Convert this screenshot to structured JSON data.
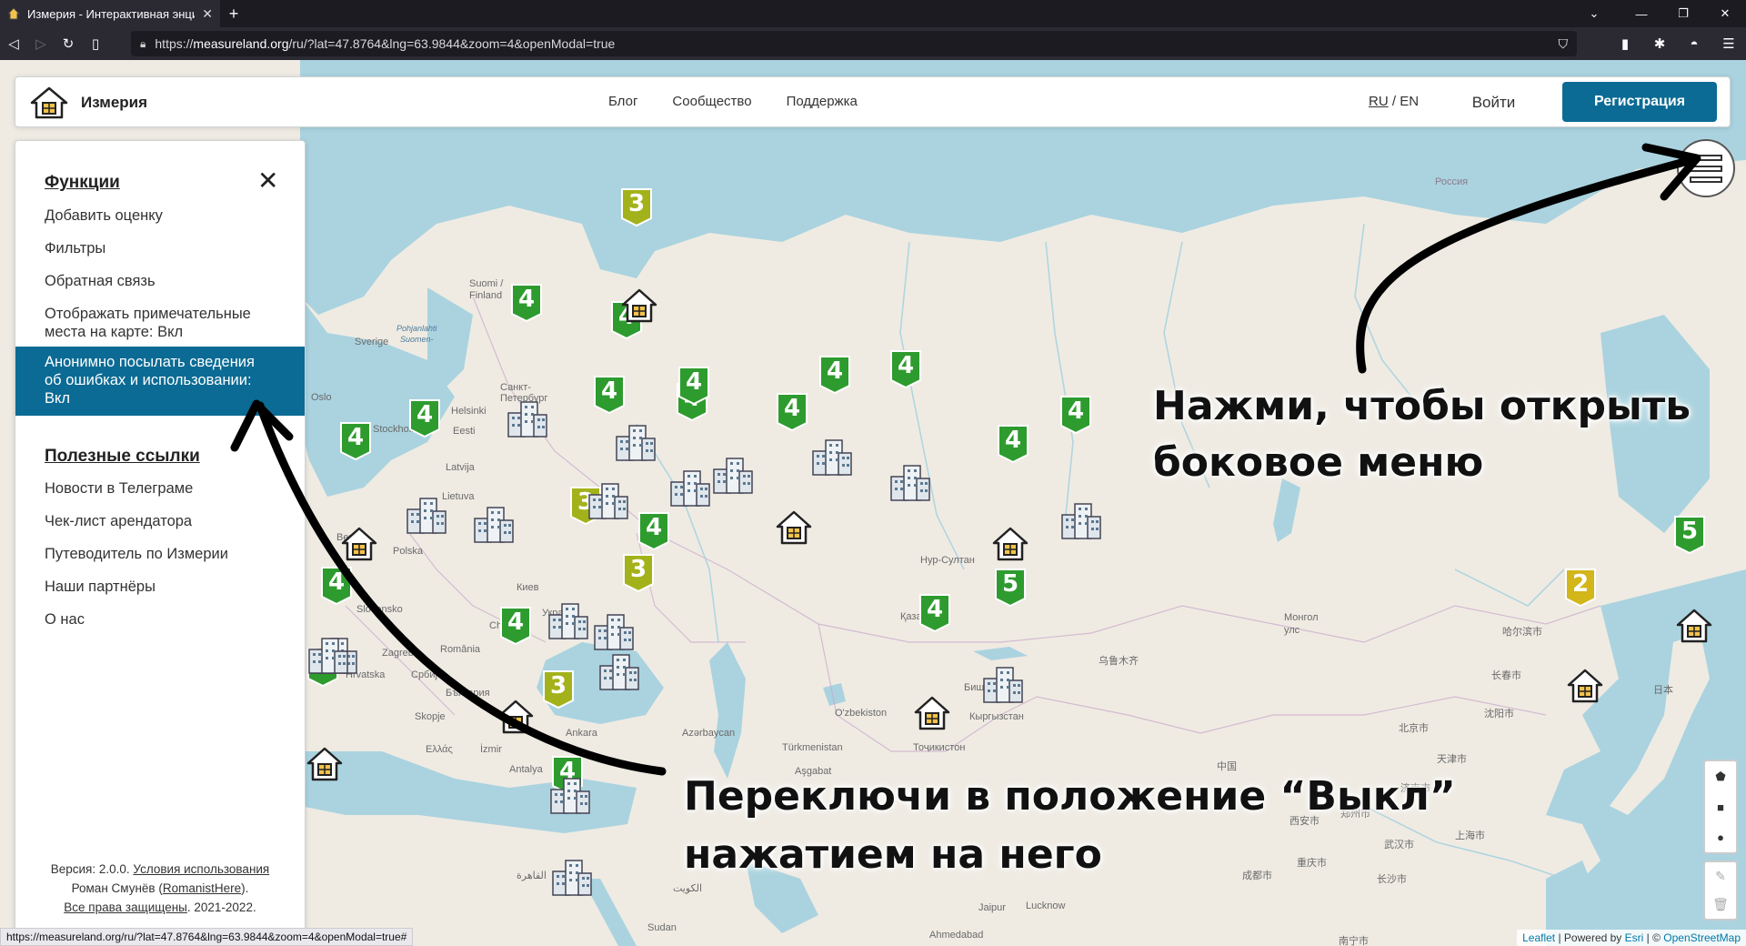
{
  "browser": {
    "tab_title": "Измерия - Интерактивная энцик",
    "new_tab": "+",
    "url_prefix": "https://",
    "url_host": "measureland.org",
    "url_path": "/ru/?lat=47.8764&lng=63.9844&zoom=4&openModal=true",
    "status_url": "https://measureland.org/ru/?lat=47.8764&lng=63.9844&zoom=4&openModal=true#"
  },
  "header": {
    "brand": "Измерия",
    "nav": [
      "Блог",
      "Сообщество",
      "Поддержка"
    ],
    "lang_ru": "RU",
    "lang_sep": " / ",
    "lang_en": "EN",
    "login": "Войти",
    "register": "Регистрация"
  },
  "sidebar": {
    "functions_heading": "Функции",
    "functions": [
      "Добавить оценку",
      "Фильтры",
      "Обратная связь",
      "Отображать примечательные места на карте: Вкл",
      "Анонимно посылать сведения об ошибках и использовании: Вкл"
    ],
    "links_heading": "Полезные ссылки",
    "links": [
      "Новости в Телеграме",
      "Чек-лист арендатора",
      "Путеводитель по Измерии",
      "Наши партнёры",
      "О нас"
    ],
    "footer": {
      "version": "Версия: 2.0.0.",
      "terms": "Условия использования",
      "author": "Роман Смунёв (",
      "author_nick": "RomanistHere",
      "author_end": ").",
      "rights": "Все права защищены",
      "years": ". 2021-2022."
    }
  },
  "annotations": {
    "burger_hint_line1": "Нажми, чтобы открыть",
    "burger_hint_line2": "боковое меню",
    "toggle_hint_line1": "Переключи в положение “Выкл”",
    "toggle_hint_line2": "нажатием на него"
  },
  "map": {
    "places": [
      "Россия",
      "Suomi / Finland",
      "Sverige",
      "Oslo",
      "Stockholm",
      "Helsinki",
      "Eesti",
      "Latvija",
      "Lietuva",
      "Polska",
      "Berlin",
      "Санкт-Петербург",
      "Киев",
      "Україна",
      "Chișinău",
      "România",
      "Slovensko",
      "Zagreb",
      "Hrvatska",
      "Србија",
      "България",
      "Skopje",
      "Ελλάς",
      "İzmir",
      "Antalya",
      "Azərbaycan",
      "Türkmenistan",
      "Aşgabat",
      "O'zbekiston",
      "Тоҷикистон",
      "Кыргызстан",
      "Бишкек",
      "Қазақстан",
      "Нур-Султан",
      "Монгол улс",
      "乌鲁木齐",
      "中国",
      "哈尔滨市",
      "长春市",
      "沈阳市",
      "北京市",
      "天津市",
      "济南市",
      "郑州市",
      "武汉市",
      "上海市",
      "日本",
      "西安市",
      "重庆市",
      "成都市",
      "长沙市",
      "南宁市",
      "Jaipur",
      "Lucknow",
      "Ahmedabad",
      "الكويت",
      "القاهرة",
      "Ankara",
      "Pohjanlahti",
      "Suomen-",
      "Sudan"
    ],
    "rating_markers": [
      3,
      4,
      4,
      4,
      4,
      4,
      4,
      4,
      4,
      4,
      4,
      4,
      4,
      3,
      4,
      3,
      4,
      4,
      4,
      4,
      5,
      3,
      4,
      2,
      5
    ],
    "attribution_leaflet": "Leaflet",
    "attribution_mid": " | Powered by ",
    "attribution_esri": "Esri",
    "attribution_sep": " | © ",
    "attribution_osm": "OpenStreetMap"
  },
  "colors": {
    "accent": "#0b6b94",
    "rating_4": "#2e9b2e",
    "rating_3": "#a3b21a",
    "rating_5": "#2e9b2e",
    "rating_2": "#d2b61a"
  }
}
